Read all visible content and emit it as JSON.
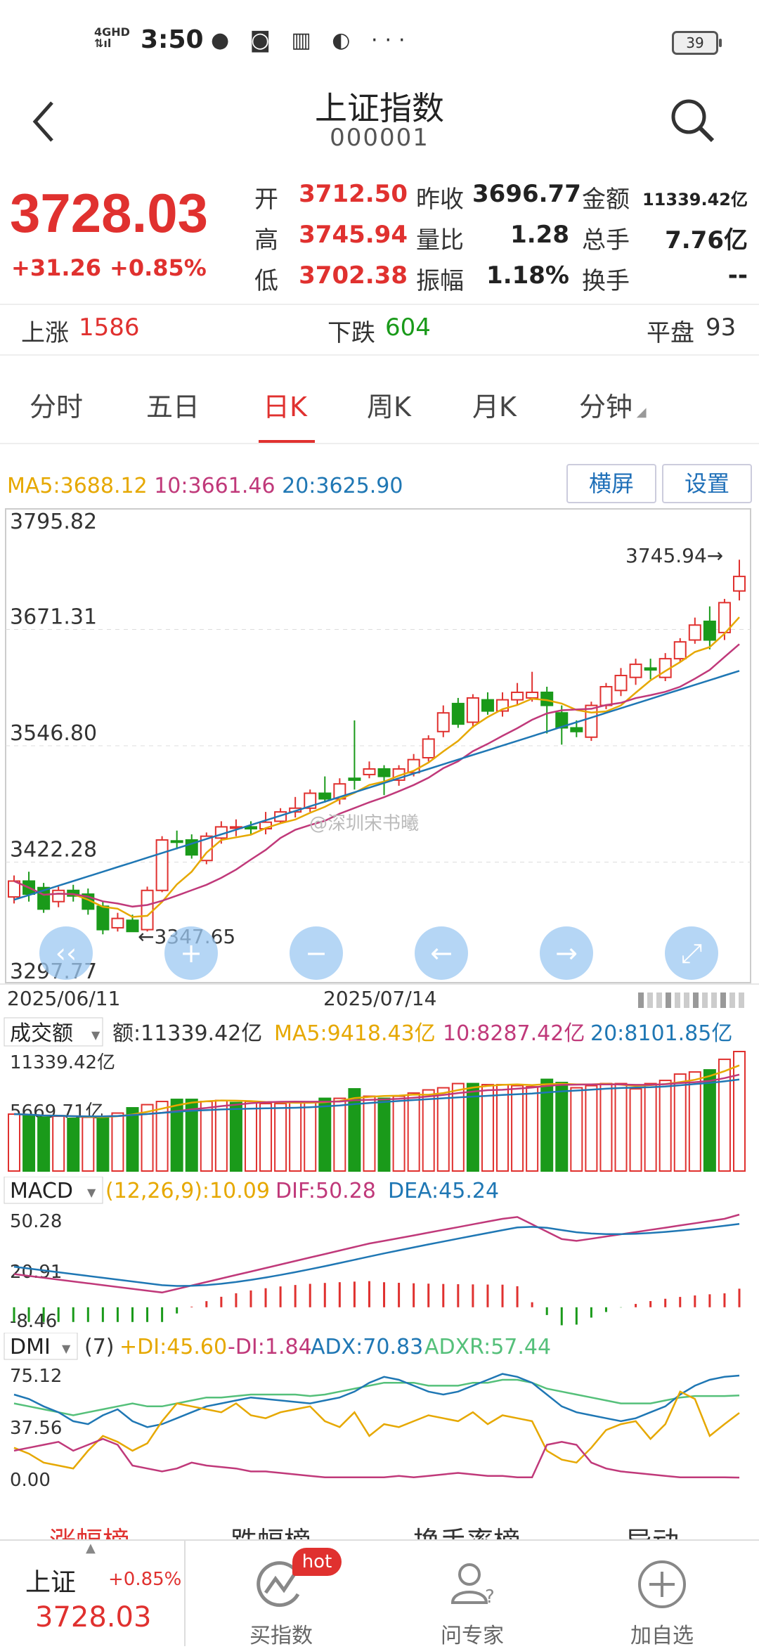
{
  "status": {
    "net_top": "4GHD",
    "net_bottom": "⇅ıl",
    "time": "3:50",
    "icons": "● ◙ ▥ ◐ ···",
    "battery": "39"
  },
  "header": {
    "title": "上证指数",
    "code": "000001"
  },
  "quote": {
    "price": "3728.03",
    "change": "+31.26",
    "change_pct": "+0.85%",
    "open_label": "开",
    "open": "3712.50",
    "prev_close_label": "昨收",
    "prev_close": "3696.77",
    "amount_label": "金额",
    "amount": "11339.42亿",
    "high_label": "高",
    "high": "3745.94",
    "vol_ratio_label": "量比",
    "vol_ratio": "1.28",
    "total_hands_label": "总手",
    "total_hands": "7.76亿",
    "low_label": "低",
    "low": "3702.38",
    "amplitude_label": "振幅",
    "amplitude": "1.18%",
    "turnover_label": "换手",
    "turnover": "--"
  },
  "breadth": {
    "up_label": "上涨",
    "up": "1586",
    "down_label": "下跌",
    "down": "604",
    "flat_label": "平盘",
    "flat": "93"
  },
  "tabs": [
    "分时",
    "五日",
    "日K",
    "周K",
    "月K",
    "分钟"
  ],
  "active_tab": "日K",
  "ma": {
    "ma5": "MA5:3688.12",
    "ma10": "10:3661.46",
    "ma20": "20:3625.90"
  },
  "buttons": {
    "landscape": "横屏",
    "settings": "设置"
  },
  "kline": {
    "y_labels": [
      "3795.82",
      "3671.31",
      "3546.80",
      "3422.28",
      "3297.77"
    ],
    "high_marker": "3745.94→",
    "low_marker": "←3347.65",
    "dates": [
      "2025/06/11",
      "2025/07/14"
    ],
    "watermark": "@深圳宋书曦"
  },
  "volume": {
    "dropdown": "成交额",
    "amount": "额:11339.42亿",
    "ma5": "MA5:9418.43亿",
    "ma10": "10:8287.42亿",
    "ma20": "20:8101.85亿",
    "y_top": "11339.42亿",
    "y_mid": "5669.71亿"
  },
  "macd": {
    "dropdown": "MACD",
    "params": "(12,26,9):10.09",
    "dif": "DIF:50.28",
    "dea": "DEA:45.24",
    "y_top": "50.28",
    "y_mid": "20.91",
    "y_bot": "-8.46"
  },
  "dmi": {
    "dropdown": "DMI",
    "params": "(7)",
    "pdi": "+DI:45.60",
    "mdi": "-DI:1.84",
    "adx": "ADX:70.83",
    "adxr": "ADXR:57.44",
    "y_top": "75.12",
    "y_mid": "37.56",
    "y_bot": "0.00"
  },
  "subtabs": [
    "涨幅榜",
    "跌幅榜",
    "换手率榜",
    "异动"
  ],
  "bottom": {
    "name": "上证",
    "pct": "+0.85%",
    "price": "3728.03",
    "buy_index": "买指数",
    "hot": "hot",
    "ask_expert": "问专家",
    "add_watch": "加自选"
  },
  "colors": {
    "up": "#e0312f",
    "down": "#1a9a1a",
    "ma5": "#e6a800",
    "ma10": "#c0397a",
    "ma20": "#1f77b4",
    "adxr": "#55c07a"
  }
}
